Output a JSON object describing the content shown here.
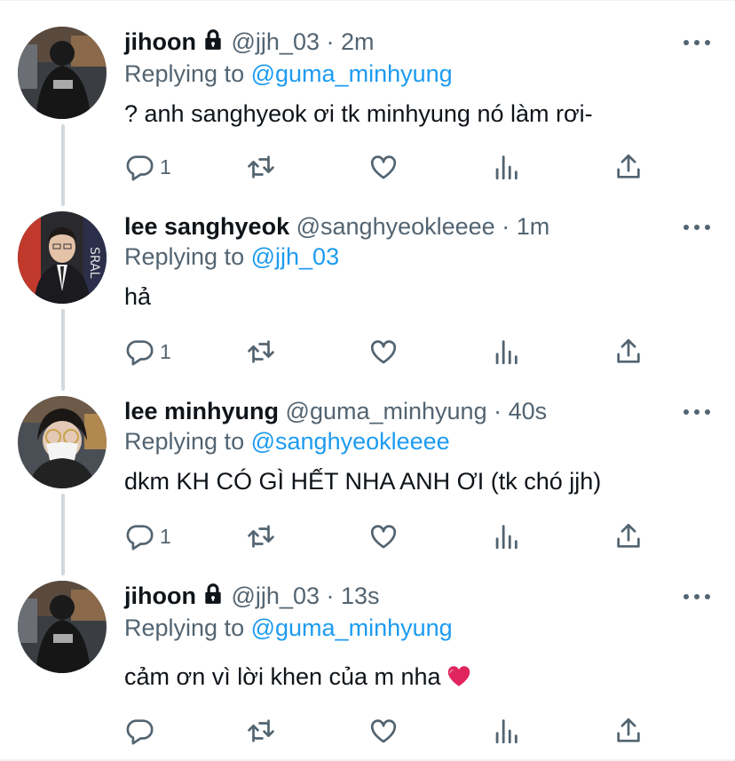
{
  "colors": {
    "accent": "#1d9bf0",
    "secondary_text": "#536471",
    "primary_text": "#0f1419",
    "thread_line": "#cfd9de",
    "heart": "#e0245e"
  },
  "tweets": [
    {
      "name": "jihoon",
      "locked": true,
      "handle": "@jjh_03",
      "sep": "·",
      "time": "2m",
      "replying_label": "Replying to",
      "replying_to": "@guma_minhyung",
      "text": "? anh sanghyeok ơi tk minhyung nó làm rơi-",
      "reply_count": "1",
      "avatar_icon": "avatar-jihoon"
    },
    {
      "name": "lee sanghyeok",
      "locked": false,
      "handle": "@sanghyeokleeee",
      "sep": "·",
      "time": "1m",
      "replying_label": "Replying to",
      "replying_to": "@jjh_03",
      "text": "hả",
      "reply_count": "1",
      "avatar_icon": "avatar-sanghyeok"
    },
    {
      "name": "lee minhyung",
      "locked": false,
      "handle": "@guma_minhyung",
      "sep": "·",
      "time": "40s",
      "replying_label": "Replying to",
      "replying_to": "@sanghyeokleeee",
      "text": "dkm KH CÓ GÌ HẾT NHA ANH ƠI (tk chó jjh)",
      "reply_count": "1",
      "avatar_icon": "avatar-minhyung"
    },
    {
      "name": "jihoon",
      "locked": true,
      "handle": "@jjh_03",
      "sep": "·",
      "time": "13s",
      "replying_label": "Replying to",
      "replying_to": "@guma_minhyung",
      "text": "cảm ơn vì lời khen của m nha",
      "text_emoji": "red-heart-emoji",
      "reply_count": "",
      "avatar_icon": "avatar-jihoon"
    }
  ]
}
